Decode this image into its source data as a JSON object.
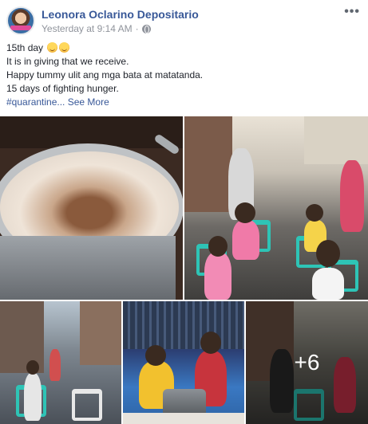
{
  "post": {
    "author": "Leonora Oclarino Depositario",
    "timestamp": "Yesterday at 9:14 AM",
    "separator": "·",
    "privacy_icon": "globe-icon",
    "more_icon": "ellipsis-icon",
    "more_glyph": "•••",
    "lines": [
      "15th day",
      "It is in giving that we receive.",
      "Happy tummy ulit ang mga bata at matatanda.",
      "15 days of fighting hunger."
    ],
    "hashtag": "#quarantine...",
    "see_more": "See More",
    "emojis": [
      "grinning-face-icon",
      "grinning-face-icon"
    ]
  },
  "photos": {
    "more_count": "+6",
    "items": [
      {
        "name": "photo-champorado-pot"
      },
      {
        "name": "photo-children-line"
      },
      {
        "name": "photo-street-chairs"
      },
      {
        "name": "photo-serving-food"
      },
      {
        "name": "photo-more"
      }
    ]
  },
  "colors": {
    "link": "#385898",
    "text": "#1d2129",
    "meta": "#90949c",
    "chair_teal": "#2ec4b6"
  }
}
